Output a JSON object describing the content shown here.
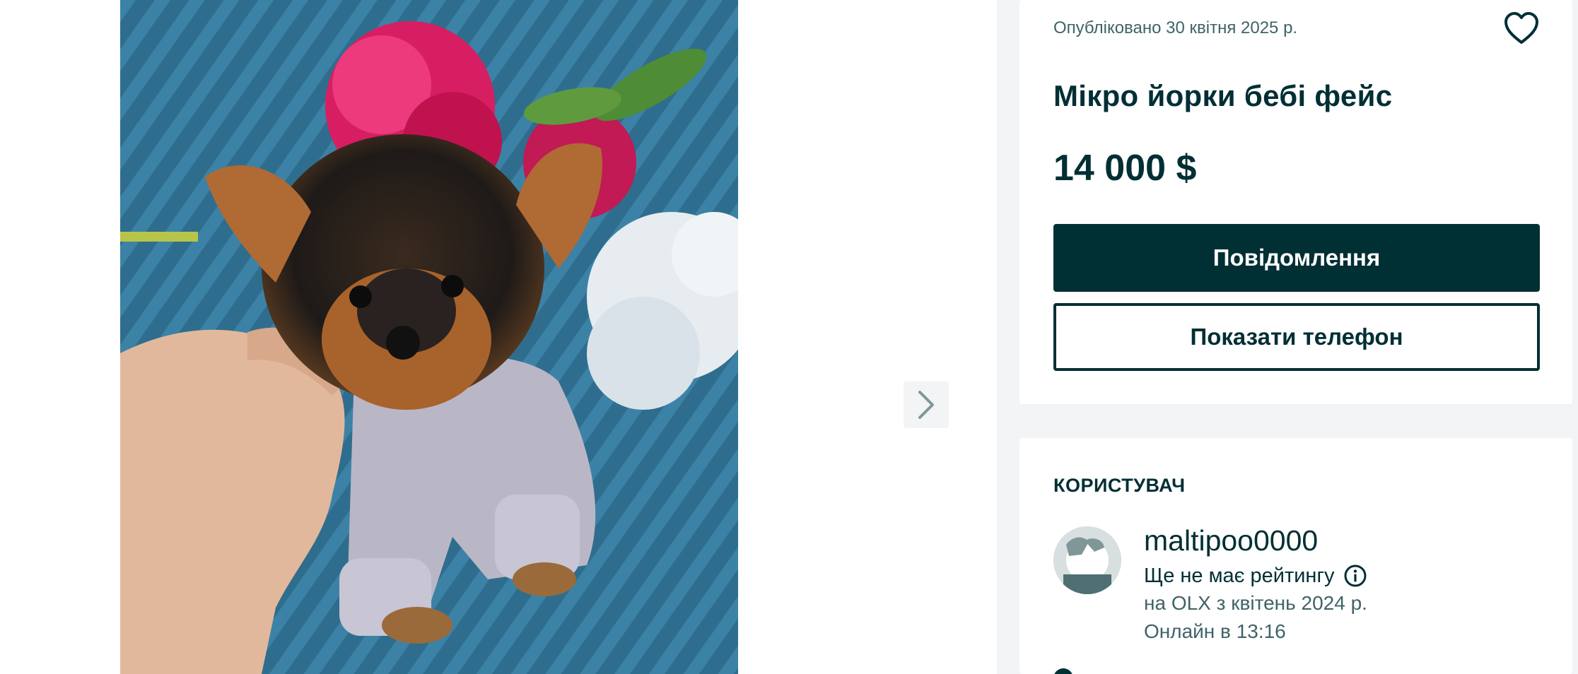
{
  "gallery": {
    "photo_alt": "Фото оголошення",
    "next_icon": "chevron-right-icon"
  },
  "listing": {
    "posted": "Опубліковано 30 квітня 2025 р.",
    "title": "Мікро йорки бебі фейс",
    "price": "14 000 $",
    "favorite_icon": "heart-outline-icon",
    "message_button": "Повідомлення",
    "phone_button": "Показати телефон"
  },
  "user": {
    "heading": "КОРИСТУВАЧ",
    "username": "maltipoo0000",
    "rating": "Ще не має рейтингу",
    "rating_info_icon": "info-icon",
    "since": "на OLX з квітень 2024 р.",
    "online": "Онлайн в 13:16"
  },
  "colors": {
    "brand_dark": "#002f34",
    "muted_text": "#406367",
    "background": "#f2f4f5"
  }
}
